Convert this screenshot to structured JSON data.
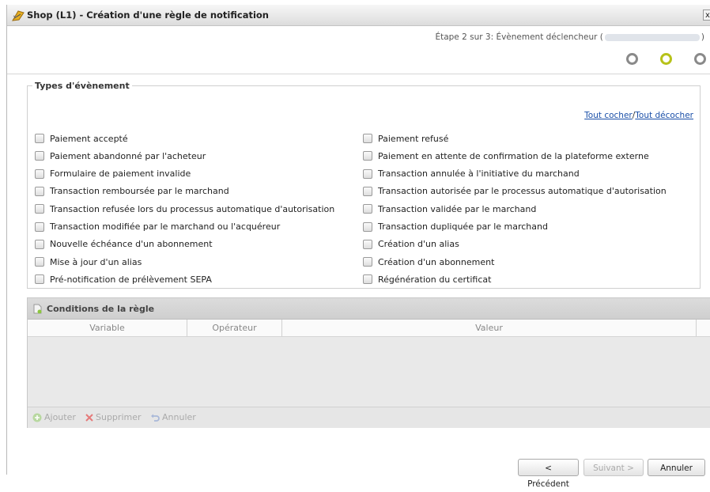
{
  "window": {
    "title": "Shop (L1) - Création d'une règle de notification",
    "close_label": "x"
  },
  "step": {
    "text": "Étape 2 sur 3: Évènement déclencheur (",
    "text_end": ")",
    "current": 2,
    "total": 3
  },
  "types": {
    "legend": "Types d'évènement",
    "check_all": "Tout cocher",
    "separator": "/",
    "uncheck_all": "Tout décocher",
    "left": [
      "Paiement accepté",
      "Paiement abandonné par l'acheteur",
      "Formulaire de paiement invalide",
      "Transaction remboursée par le marchand",
      "Transaction refusée lors du processus automatique d'autorisation",
      "Transaction modifiée par le marchand ou l'acquéreur",
      "Nouvelle échéance d'un abonnement",
      "Mise à jour d'un alias",
      "Pré-notification de prélèvement SEPA"
    ],
    "right": [
      "Paiement refusé",
      "Paiement en attente de confirmation de la plateforme externe",
      "Transaction annulée à l'initiative du marchand",
      "Transaction autorisée par le processus automatique d'autorisation",
      "Transaction validée par le marchand",
      "Transaction dupliquée par le marchand",
      "Création d'un alias",
      "Création d'un abonnement",
      "Régénération du certificat"
    ]
  },
  "conditions": {
    "title": "Conditions de la règle",
    "columns": [
      "Variable",
      "Opérateur",
      "Valeur"
    ],
    "toolbar": {
      "add": "Ajouter",
      "delete": "Supprimer",
      "cancel": "Annuler"
    }
  },
  "footer": {
    "previous": "< Précédent",
    "next": "Suivant >",
    "cancel": "Annuler"
  },
  "colors": {
    "active_step": "#b7c21a",
    "inactive_step": "#8a8a8a",
    "link": "#1a4fa8"
  }
}
